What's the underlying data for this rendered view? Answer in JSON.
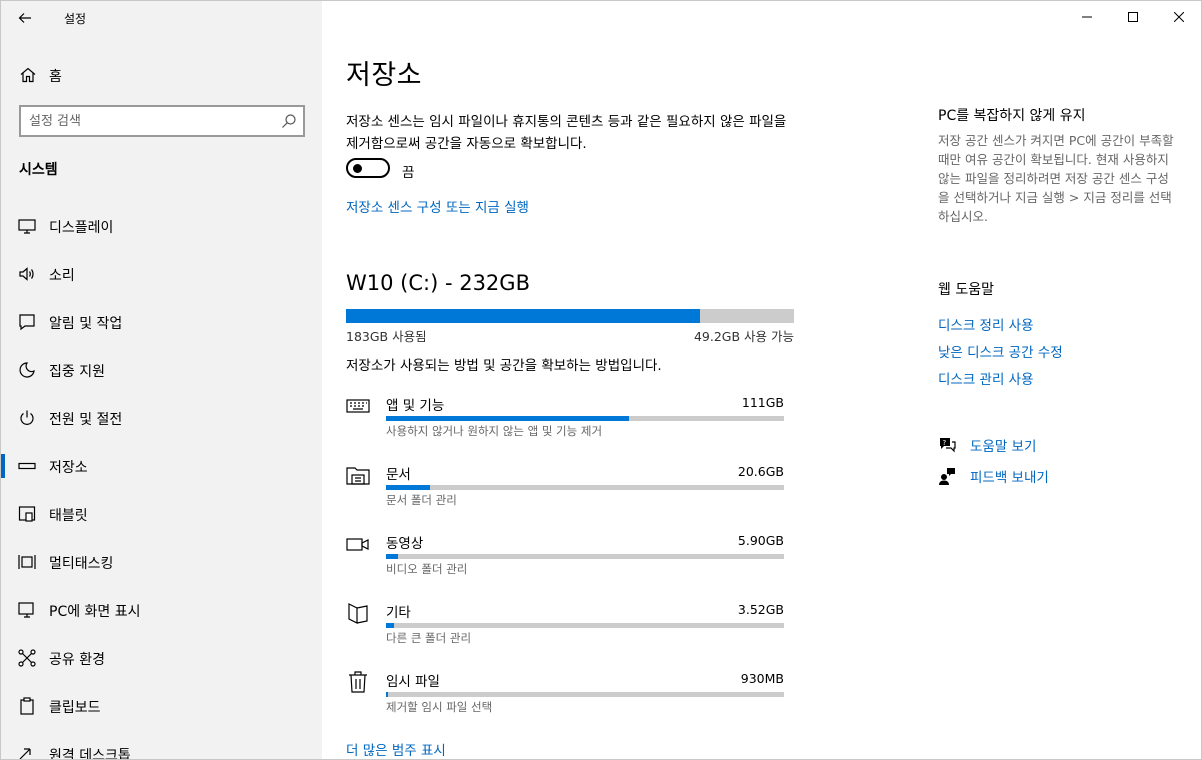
{
  "app_title": "설정",
  "sidebar": {
    "home_label": "홈",
    "search_placeholder": "설정 검색",
    "section_title": "시스템",
    "items": [
      {
        "label": "디스플레이",
        "icon": "display-icon"
      },
      {
        "label": "소리",
        "icon": "sound-icon"
      },
      {
        "label": "알림 및 작업",
        "icon": "notifications-icon"
      },
      {
        "label": "집중 지원",
        "icon": "focus-assist-icon"
      },
      {
        "label": "전원 및 절전",
        "icon": "power-icon"
      },
      {
        "label": "저장소",
        "icon": "storage-icon",
        "active": true
      },
      {
        "label": "태블릿",
        "icon": "tablet-icon"
      },
      {
        "label": "멀티태스킹",
        "icon": "multitasking-icon"
      },
      {
        "label": "PC에 화면 표시",
        "icon": "projecting-icon"
      },
      {
        "label": "공유 환경",
        "icon": "shared-experiences-icon"
      },
      {
        "label": "클립보드",
        "icon": "clipboard-icon"
      },
      {
        "label": "원격 데스크톱",
        "icon": "remote-desktop-icon"
      }
    ]
  },
  "main": {
    "title": "저장소",
    "description": "저장소 센스는 임시 파일이나 휴지통의 콘텐츠 등과 같은 필요하지 않은 파일을 제거함으로써 공간을 자동으로 확보합니다.",
    "toggle_state": "끔",
    "sense_link": "저장소 센스 구성 또는 지금 실행",
    "drive": {
      "title": "W10 (C:) - 232GB",
      "used_label": "183GB 사용됨",
      "free_label": "49.2GB 사용 가능",
      "used_fraction": 0.79
    },
    "usage_description": "저장소가 사용되는 방법 및 공간을 확보하는 방법입니다.",
    "categories": [
      {
        "name": "앱 및 기능",
        "size": "111GB",
        "sub": "사용하지 않거나 원하지 않는 앱 및 기능 제거",
        "fraction": 0.61,
        "icon": "apps-keyboard-icon"
      },
      {
        "name": "문서",
        "size": "20.6GB",
        "sub": "문서 폴더 관리",
        "fraction": 0.11,
        "icon": "documents-icon"
      },
      {
        "name": "동영상",
        "size": "5.90GB",
        "sub": "비디오 폴더 관리",
        "fraction": 0.03,
        "icon": "video-icon"
      },
      {
        "name": "기타",
        "size": "3.52GB",
        "sub": "다른 큰 폴더 관리",
        "fraction": 0.02,
        "icon": "other-folder-icon"
      },
      {
        "name": "임시 파일",
        "size": "930MB",
        "sub": "제거할 임시 파일 선택",
        "fraction": 0.005,
        "icon": "trash-icon"
      }
    ],
    "more_link": "더 많은 범주 표시"
  },
  "right": {
    "keep_title": "PC를 복잡하지 않게 유지",
    "keep_desc": "저장 공간 센스가 켜지면 PC에 공간이 부족할 때만 여유 공간이 확보됩니다. 현재 사용하지 않는 파일을 정리하려면 저장 공간 센스 구성을 선택하거나 지금 실행 > 지금 정리를 선택하십시오.",
    "help_title": "웹 도움말",
    "help_links": [
      "디스크 정리 사용",
      "낮은 디스크 공간 수정",
      "디스크 관리 사용"
    ],
    "get_help": "도움말 보기",
    "feedback": "피드백 보내기"
  },
  "colors": {
    "accent": "#0078d7",
    "link": "#0067c0",
    "sidebar_bg": "#f2f2f2"
  }
}
